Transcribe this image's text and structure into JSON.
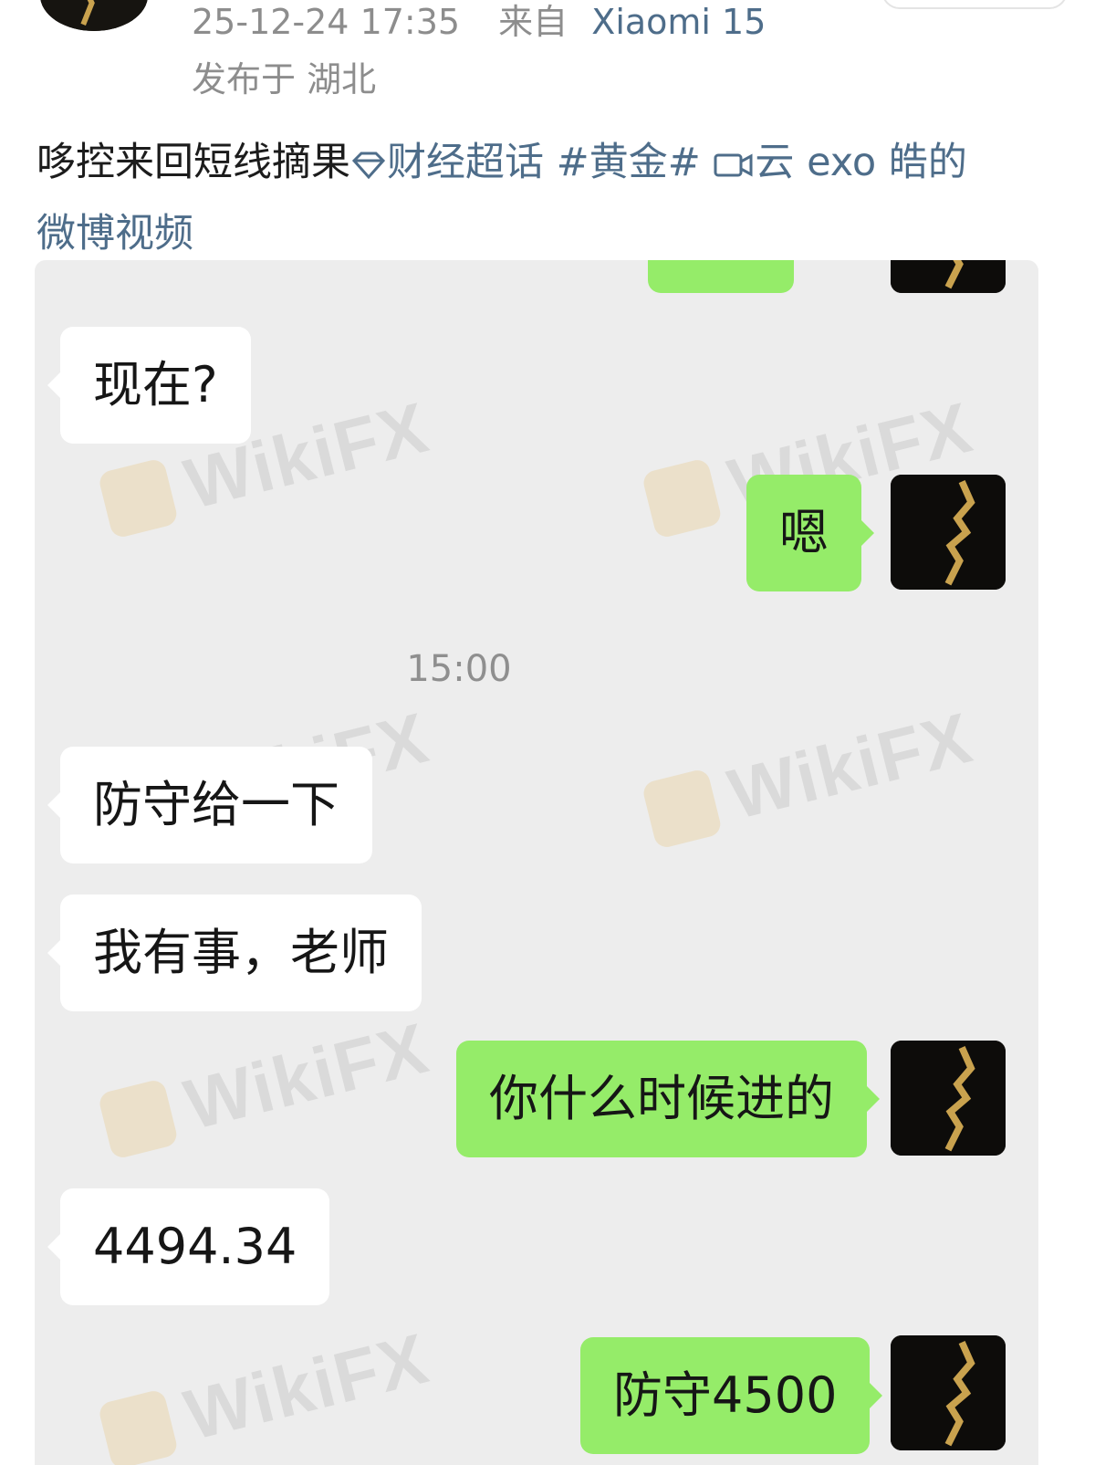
{
  "post_meta": {
    "timestamp": "25-12-24 17:35",
    "source_label": "来自",
    "device": "Xiaomi 15",
    "location": "发布于 湖北"
  },
  "post_body": {
    "text": "哆控来回短线摘果",
    "topic_link": "财经超话",
    "hashtag": "#黄金#",
    "video_link_part1": "云 exo 皓的",
    "video_link_part2": "微博视频"
  },
  "chat": {
    "messages": [
      {
        "side": "left",
        "text": "现在?"
      },
      {
        "side": "right",
        "text": "嗯"
      },
      {
        "side": "time",
        "text": "15:00"
      },
      {
        "side": "left",
        "text": "防守给一下"
      },
      {
        "side": "left",
        "text": "我有事，老师"
      },
      {
        "side": "right",
        "text": "你什么时候进的"
      },
      {
        "side": "left",
        "text": "4494.34"
      },
      {
        "side": "right",
        "text": "防守4500"
      }
    ]
  },
  "watermark": {
    "text": "WikiFX"
  },
  "colors": {
    "link": "#4e6d8a",
    "bubble_right": "#95ec69",
    "bubble_left": "#ffffff",
    "chat_bg": "#ededed"
  }
}
